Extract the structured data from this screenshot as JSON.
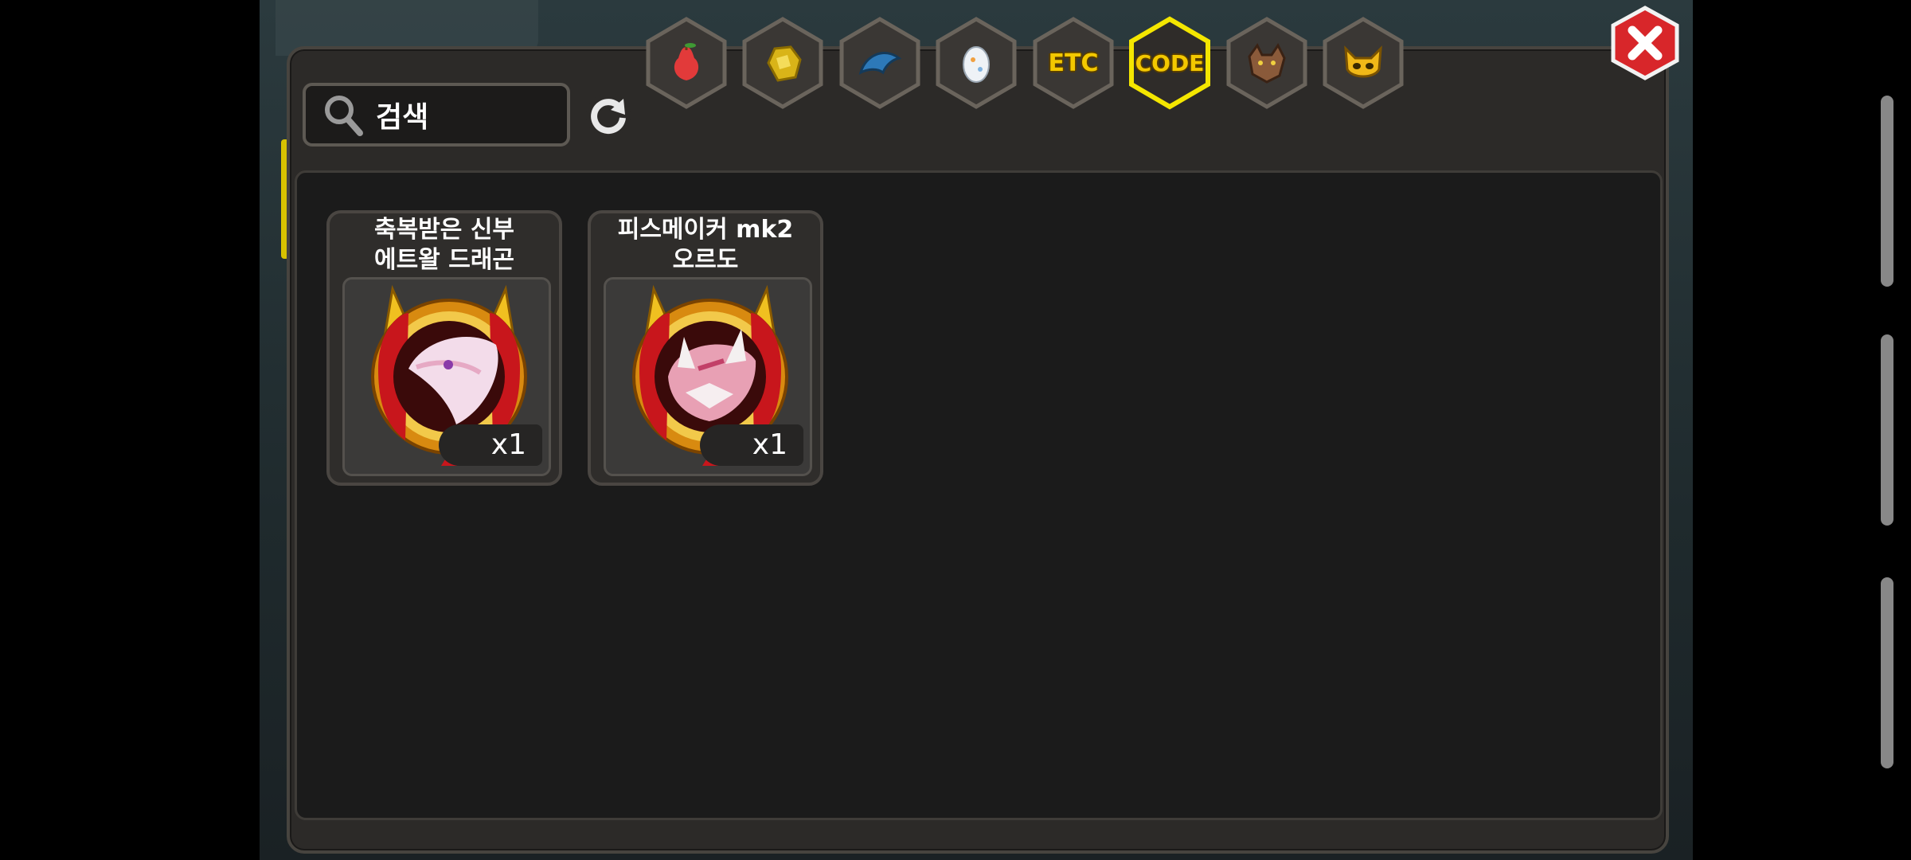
{
  "search": {
    "placeholder": "검색"
  },
  "tabs": [
    {
      "name": "fruit",
      "icon": "pear-icon"
    },
    {
      "name": "gold-nugget",
      "icon": "gold-nugget-icon"
    },
    {
      "name": "blue-shard",
      "icon": "blue-shard-icon"
    },
    {
      "name": "egg",
      "icon": "egg-icon"
    },
    {
      "name": "etc",
      "label": "ETC"
    },
    {
      "name": "code",
      "label": "CODE",
      "selected": true
    },
    {
      "name": "beast",
      "icon": "beast-icon"
    },
    {
      "name": "mask",
      "icon": "mask-icon"
    }
  ],
  "items": [
    {
      "name_line1": "축복받은 신부",
      "name_line2": "에트왈 드래곤",
      "qty": "x1",
      "icon": "etoile-dragon-icon"
    },
    {
      "name_line1": "피스메이커 mk2",
      "name_line2": "오르도",
      "qty": "x1",
      "icon": "ordo-dragon-icon"
    }
  ],
  "colors": {
    "accent_selected": "#f4e600",
    "label_gold": "#f3c800",
    "close_red": "#d8262a"
  }
}
